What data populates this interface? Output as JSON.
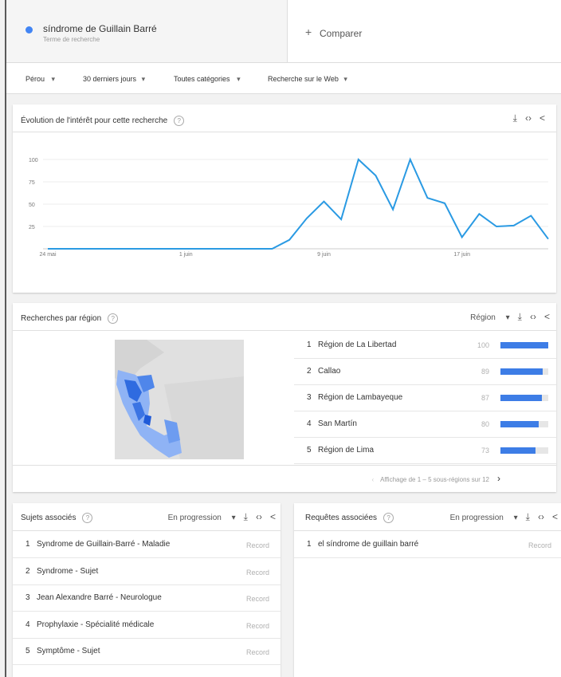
{
  "search": {
    "term": "síndrome de Guillain Barré",
    "subtitle": "Terme de recherche",
    "compare_label": "Comparer",
    "color": "#4285f4"
  },
  "filters": {
    "country": "Pérou",
    "period": "30 derniers jours",
    "category": "Toutes catégories",
    "search_type": "Recherche sur le Web"
  },
  "interest": {
    "title": "Évolution de l'intérêt pour cette recherche",
    "chart_data": {
      "type": "line",
      "x": [
        "24 mai",
        "25 mai",
        "26 mai",
        "27 mai",
        "28 mai",
        "29 mai",
        "30 mai",
        "31 mai",
        "1 juin",
        "2 juin",
        "3 juin",
        "4 juin",
        "5 juin",
        "6 juin",
        "7 juin",
        "8 juin",
        "9 juin",
        "10 juin",
        "11 juin",
        "12 juin",
        "13 juin",
        "14 juin",
        "15 juin",
        "16 juin",
        "17 juin",
        "18 juin",
        "19 juin",
        "20 juin",
        "21 juin",
        "22 juin"
      ],
      "series": [
        {
          "values": [
            0,
            0,
            0,
            0,
            0,
            0,
            0,
            0,
            0,
            0,
            0,
            0,
            0,
            0,
            10,
            34,
            53,
            33,
            100,
            82,
            44,
            100,
            57,
            51,
            13,
            39,
            25,
            26,
            37,
            11
          ]
        }
      ],
      "yticks": [
        "100",
        "75",
        "50",
        "25"
      ],
      "xticks": [
        "24 mai",
        "1 juin",
        "9 juin",
        "17 juin"
      ],
      "ylim": [
        0,
        100
      ],
      "color": "#2a9ae3"
    }
  },
  "region": {
    "title": "Recherches par région",
    "selector": "Région",
    "rows": [
      {
        "rank": "1",
        "name": "Région de La Libertad",
        "value": "100",
        "v": 100
      },
      {
        "rank": "2",
        "name": "Callao",
        "value": "89",
        "v": 89
      },
      {
        "rank": "3",
        "name": "Région de Lambayeque",
        "value": "87",
        "v": 87
      },
      {
        "rank": "4",
        "name": "San Martín",
        "value": "80",
        "v": 80
      },
      {
        "rank": "5",
        "name": "Région de Lima",
        "value": "73",
        "v": 73
      }
    ],
    "pagination": "Affichage de 1 – 5 sous-régions sur 12"
  },
  "topics": {
    "title": "Sujets associés",
    "mode": "En progression",
    "rows": [
      {
        "rank": "1",
        "name": "Syndrome de Guillain-Barré - Maladie",
        "value": "Record"
      },
      {
        "rank": "2",
        "name": "Syndrome - Sujet",
        "value": "Record"
      },
      {
        "rank": "3",
        "name": "Jean Alexandre Barré - Neurologue",
        "value": "Record"
      },
      {
        "rank": "4",
        "name": "Prophylaxie - Spécialité médicale",
        "value": "Record"
      },
      {
        "rank": "5",
        "name": "Symptôme - Sujet",
        "value": "Record"
      }
    ]
  },
  "queries": {
    "title": "Requêtes associées",
    "mode": "En progression",
    "rows": [
      {
        "rank": "1",
        "name": "el síndrome de guillain barré",
        "value": "Record"
      }
    ]
  },
  "icons": {
    "download": "download-icon",
    "embed": "embed-icon",
    "share": "share-icon",
    "help": "help-icon"
  }
}
